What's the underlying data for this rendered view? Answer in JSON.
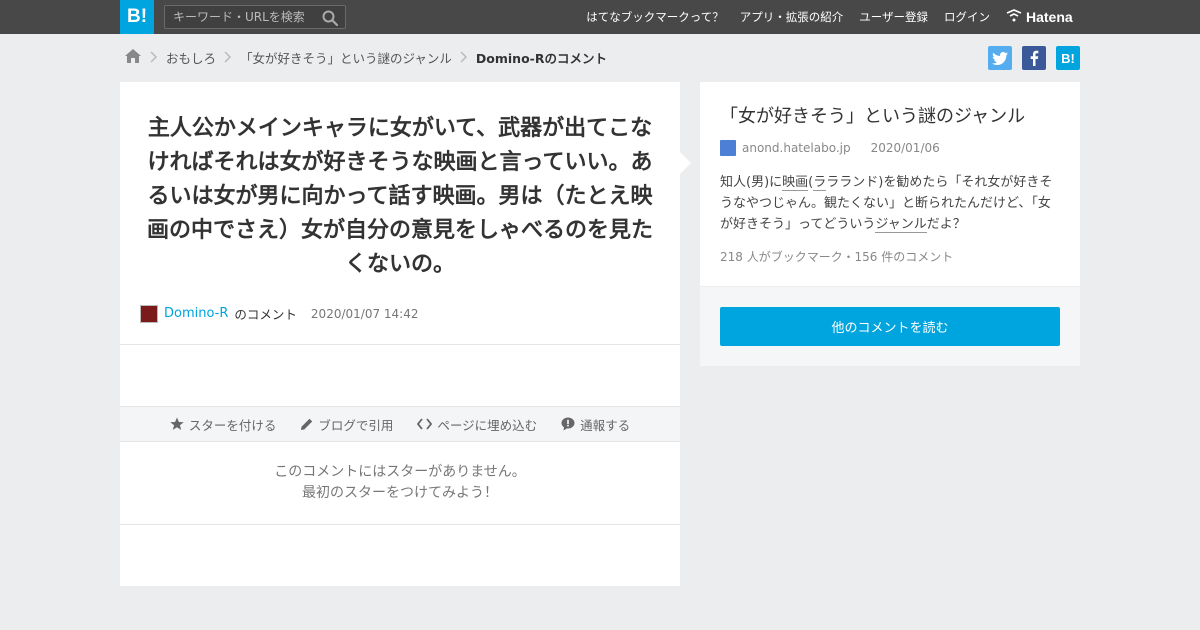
{
  "header": {
    "logo_text": "B!",
    "search_placeholder": "キーワード・URLを検索",
    "nav": [
      "はてなブックマークって？",
      "アプリ・拡張の紹介",
      "ユーザー登録",
      "ログイン"
    ],
    "brand": "Hatena"
  },
  "breadcrumb": {
    "items": [
      "おもしろ",
      "「女が好きそう」という謎のジャンル"
    ],
    "current": "Domino-Rのコメント"
  },
  "share": {
    "hatena_label": "B!"
  },
  "comment": {
    "text": "主人公かメインキャラに女がいて、武器が出てこなければそれは女が好きそうな映画と言っていい。あるいは女が男に向かって話す映画。男は（たとえ映画の中でさえ）女が自分の意見をしゃべるのを見たくないの。",
    "user": "Domino-R",
    "user_suffix": "のコメント",
    "date": "2020/01/07 14:42"
  },
  "actions": {
    "star": "スターを付ける",
    "blog": "ブログで引用",
    "embed": "ページに埋め込む",
    "report": "通報する"
  },
  "stars_empty": {
    "line1": "このコメントにはスターがありません。",
    "line2": "最初のスターをつけてみよう！"
  },
  "entry": {
    "title": "「女が好きそう」という謎のジャンル",
    "domain": "anond.hatelabo.jp",
    "date": "2020/01/06",
    "summary_parts": [
      "知人(男)に",
      "映画",
      "(",
      "ラ",
      "ラランド)を勧めたら「それ女が好きそうなやつじゃん。観たくない」と断られたんだけど、「女が好きそう」ってどういう",
      "ジャンル",
      "だよ？"
    ],
    "stats": "218 人がブックマーク・156 件のコメント",
    "read_button": "他のコメントを読む"
  },
  "colors": {
    "accent": "#00a4de",
    "header_bg": "#484848",
    "page_bg": "#ebedef"
  }
}
